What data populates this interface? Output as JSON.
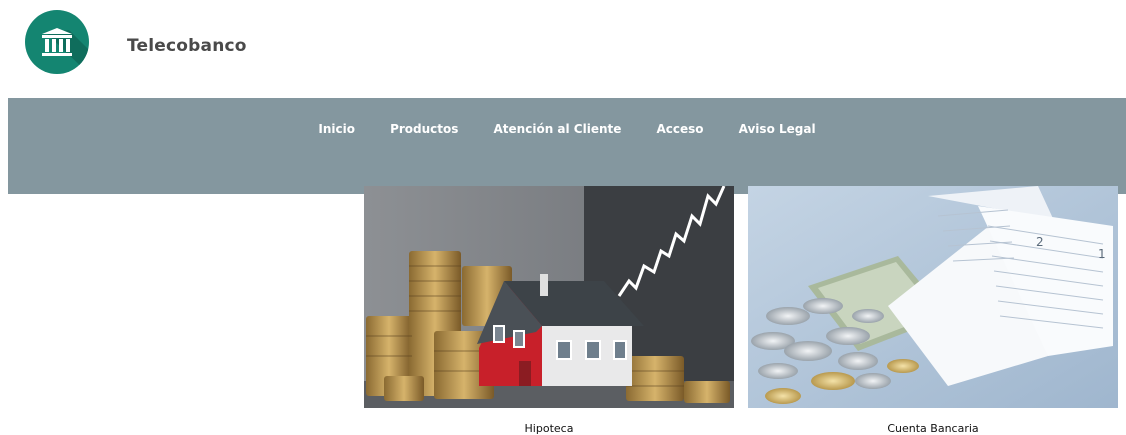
{
  "header": {
    "brand_name": "Telecobanco",
    "logo_icon": "bank-building-icon",
    "logo_color": "#148571"
  },
  "nav": {
    "background": "#84979f",
    "items": [
      {
        "label": "Inicio"
      },
      {
        "label": "Productos"
      },
      {
        "label": "Atención al Cliente"
      },
      {
        "label": "Acceso"
      },
      {
        "label": "Aviso Legal"
      }
    ]
  },
  "products": [
    {
      "caption": "Hipoteca",
      "image": "house-coins-chart-image"
    },
    {
      "caption": "Cuenta Bancaria",
      "image": "bank-book-coins-image"
    }
  ]
}
